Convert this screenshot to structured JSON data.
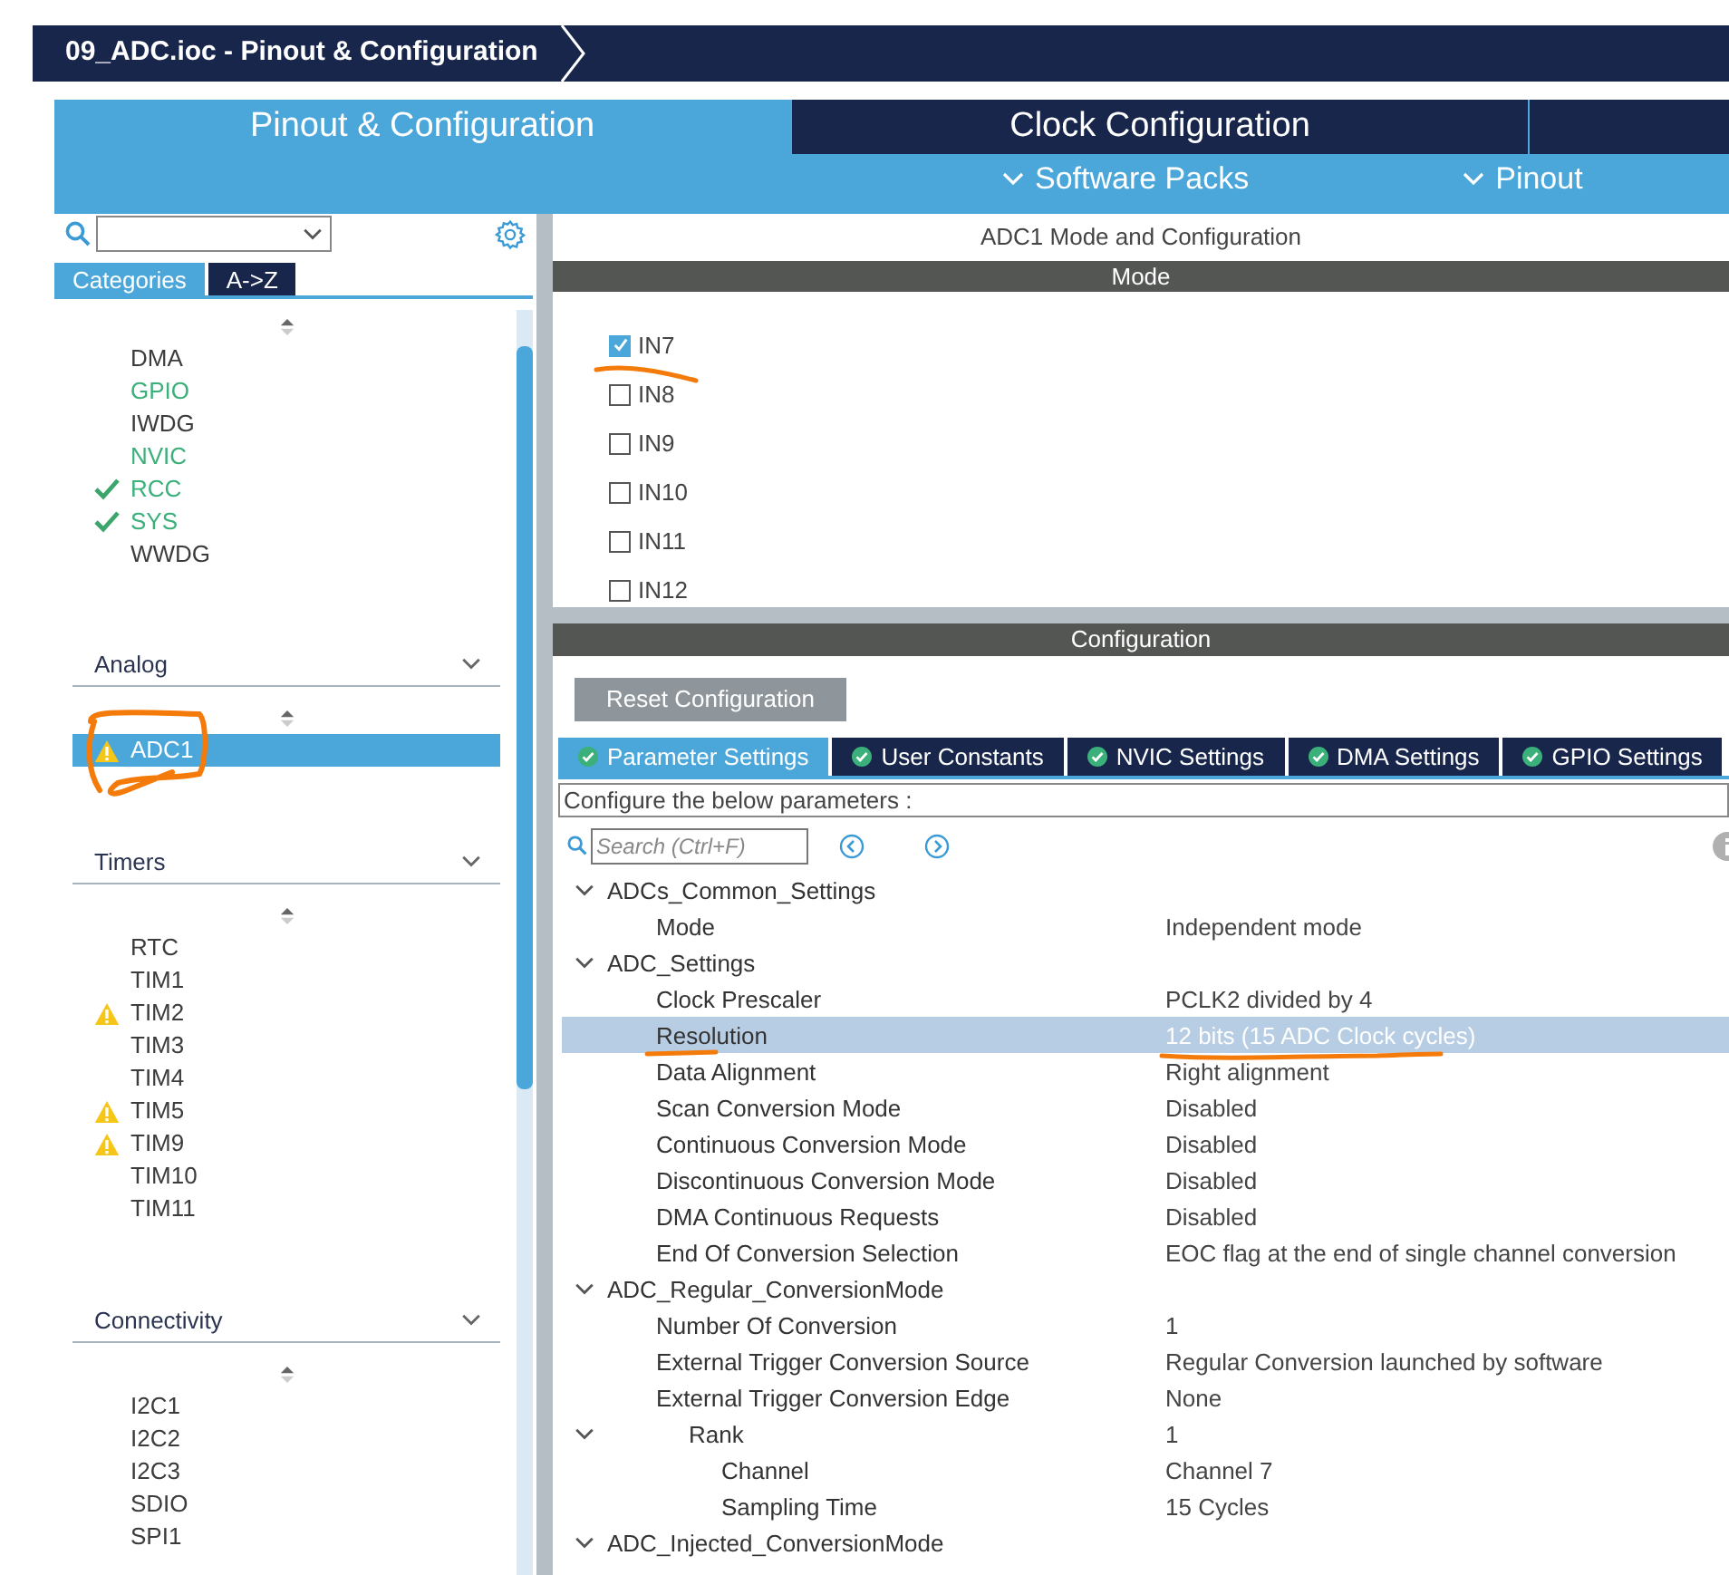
{
  "window": {
    "title": "09_ADC.ioc - Pinout & Configuration"
  },
  "main_tabs": [
    {
      "label": "Pinout & Configuration",
      "selected": true
    },
    {
      "label": "Clock Configuration",
      "selected": false
    },
    {
      "selected": false
    }
  ],
  "sub_menus": [
    {
      "label": "Software Packs"
    },
    {
      "label": "Pinout"
    }
  ],
  "sidebar": {
    "view_tabs": [
      {
        "label": "Categories",
        "selected": true
      },
      {
        "label": "A->Z",
        "selected": false
      }
    ],
    "sections": [
      {
        "items": [
          {
            "label": "DMA",
            "kind": "plain",
            "configured": false,
            "selected": false
          },
          {
            "label": "GPIO",
            "kind": "plain",
            "configured": true,
            "selected": false
          },
          {
            "label": "IWDG",
            "kind": "plain",
            "configured": false,
            "selected": false
          },
          {
            "label": "NVIC",
            "kind": "plain",
            "configured": true,
            "selected": false
          },
          {
            "label": "RCC",
            "kind": "check",
            "configured": true,
            "selected": false
          },
          {
            "label": "SYS",
            "kind": "check",
            "configured": true,
            "selected": false
          },
          {
            "label": "WWDG",
            "kind": "plain",
            "configured": false,
            "selected": false
          }
        ]
      },
      {
        "title": "Analog",
        "items": [
          {
            "label": "ADC1",
            "kind": "warning",
            "configured": false,
            "selected": true
          }
        ]
      },
      {
        "title": "Timers",
        "items": [
          {
            "label": "RTC",
            "kind": "plain",
            "configured": false,
            "selected": false
          },
          {
            "label": "TIM1",
            "kind": "plain",
            "configured": false,
            "selected": false
          },
          {
            "label": "TIM2",
            "kind": "warning",
            "configured": false,
            "selected": false
          },
          {
            "label": "TIM3",
            "kind": "plain",
            "configured": false,
            "selected": false
          },
          {
            "label": "TIM4",
            "kind": "plain",
            "configured": false,
            "selected": false
          },
          {
            "label": "TIM5",
            "kind": "warning",
            "configured": false,
            "selected": false
          },
          {
            "label": "TIM9",
            "kind": "warning",
            "configured": false,
            "selected": false
          },
          {
            "label": "TIM10",
            "kind": "plain",
            "configured": false,
            "selected": false
          },
          {
            "label": "TIM11",
            "kind": "plain",
            "configured": false,
            "selected": false
          }
        ]
      },
      {
        "title": "Connectivity",
        "items": [
          {
            "label": "I2C1",
            "kind": "plain",
            "configured": false,
            "selected": false
          },
          {
            "label": "I2C2",
            "kind": "plain",
            "configured": false,
            "selected": false
          },
          {
            "label": "I2C3",
            "kind": "plain",
            "configured": false,
            "selected": false
          },
          {
            "label": "SDIO",
            "kind": "plain",
            "configured": false,
            "selected": false
          },
          {
            "label": "SPI1",
            "kind": "plain",
            "configured": false,
            "selected": false
          }
        ]
      }
    ]
  },
  "panel": {
    "title": "ADC1 Mode and Configuration",
    "mode_header": "Mode",
    "channels": [
      {
        "label": "IN7",
        "checked": true
      },
      {
        "label": "IN8",
        "checked": false
      },
      {
        "label": "IN9",
        "checked": false
      },
      {
        "label": "IN10",
        "checked": false
      },
      {
        "label": "IN11",
        "checked": false
      },
      {
        "label": "IN12",
        "checked": false
      }
    ],
    "config_header": "Configuration",
    "reset_button": "Reset Configuration",
    "config_tabs": [
      {
        "label": "Parameter Settings",
        "selected": true
      },
      {
        "label": "User Constants",
        "selected": false
      },
      {
        "label": "NVIC Settings",
        "selected": false
      },
      {
        "label": "DMA Settings",
        "selected": false
      },
      {
        "label": "GPIO Settings",
        "selected": false
      }
    ],
    "hint": "Configure the below parameters :",
    "search": {
      "placeholder": "Search (Ctrl+F)"
    },
    "parameters": [
      {
        "label": "ADCs_Common_Settings",
        "expanded": true,
        "children": [
          {
            "label": "Mode",
            "value": "Independent mode",
            "selected": false
          }
        ]
      },
      {
        "label": "ADC_Settings",
        "expanded": true,
        "children": [
          {
            "label": "Clock Prescaler",
            "value": "PCLK2 divided by 4",
            "selected": false
          },
          {
            "label": "Resolution",
            "value": "12 bits (15 ADC Clock cycles)",
            "selected": true
          },
          {
            "label": "Data Alignment",
            "value": "Right alignment",
            "selected": false
          },
          {
            "label": "Scan Conversion Mode",
            "value": "Disabled",
            "selected": false
          },
          {
            "label": "Continuous Conversion Mode",
            "value": "Disabled",
            "selected": false
          },
          {
            "label": "Discontinuous Conversion Mode",
            "value": "Disabled",
            "selected": false
          },
          {
            "label": "DMA Continuous Requests",
            "value": "Disabled",
            "selected": false
          },
          {
            "label": "End Of Conversion Selection",
            "value": "EOC flag at the end of single channel conversion",
            "selected": false
          }
        ]
      },
      {
        "label": "ADC_Regular_ConversionMode",
        "expanded": true,
        "children": [
          {
            "label": "Number Of Conversion",
            "value": "1",
            "selected": false
          },
          {
            "label": "External Trigger Conversion Source",
            "value": "Regular Conversion launched by software",
            "selected": false
          },
          {
            "label": "External Trigger Conversion Edge",
            "value": "None",
            "selected": false
          },
          {
            "label": "Rank",
            "value": "1",
            "selected": false,
            "expanded": true,
            "children": [
              {
                "label": "Channel",
                "value": "Channel 7",
                "selected": false
              },
              {
                "label": "Sampling Time",
                "value": "15 Cycles",
                "selected": false
              }
            ]
          }
        ]
      },
      {
        "label": "ADC_Injected_ConversionMode",
        "expanded": true
      }
    ]
  }
}
